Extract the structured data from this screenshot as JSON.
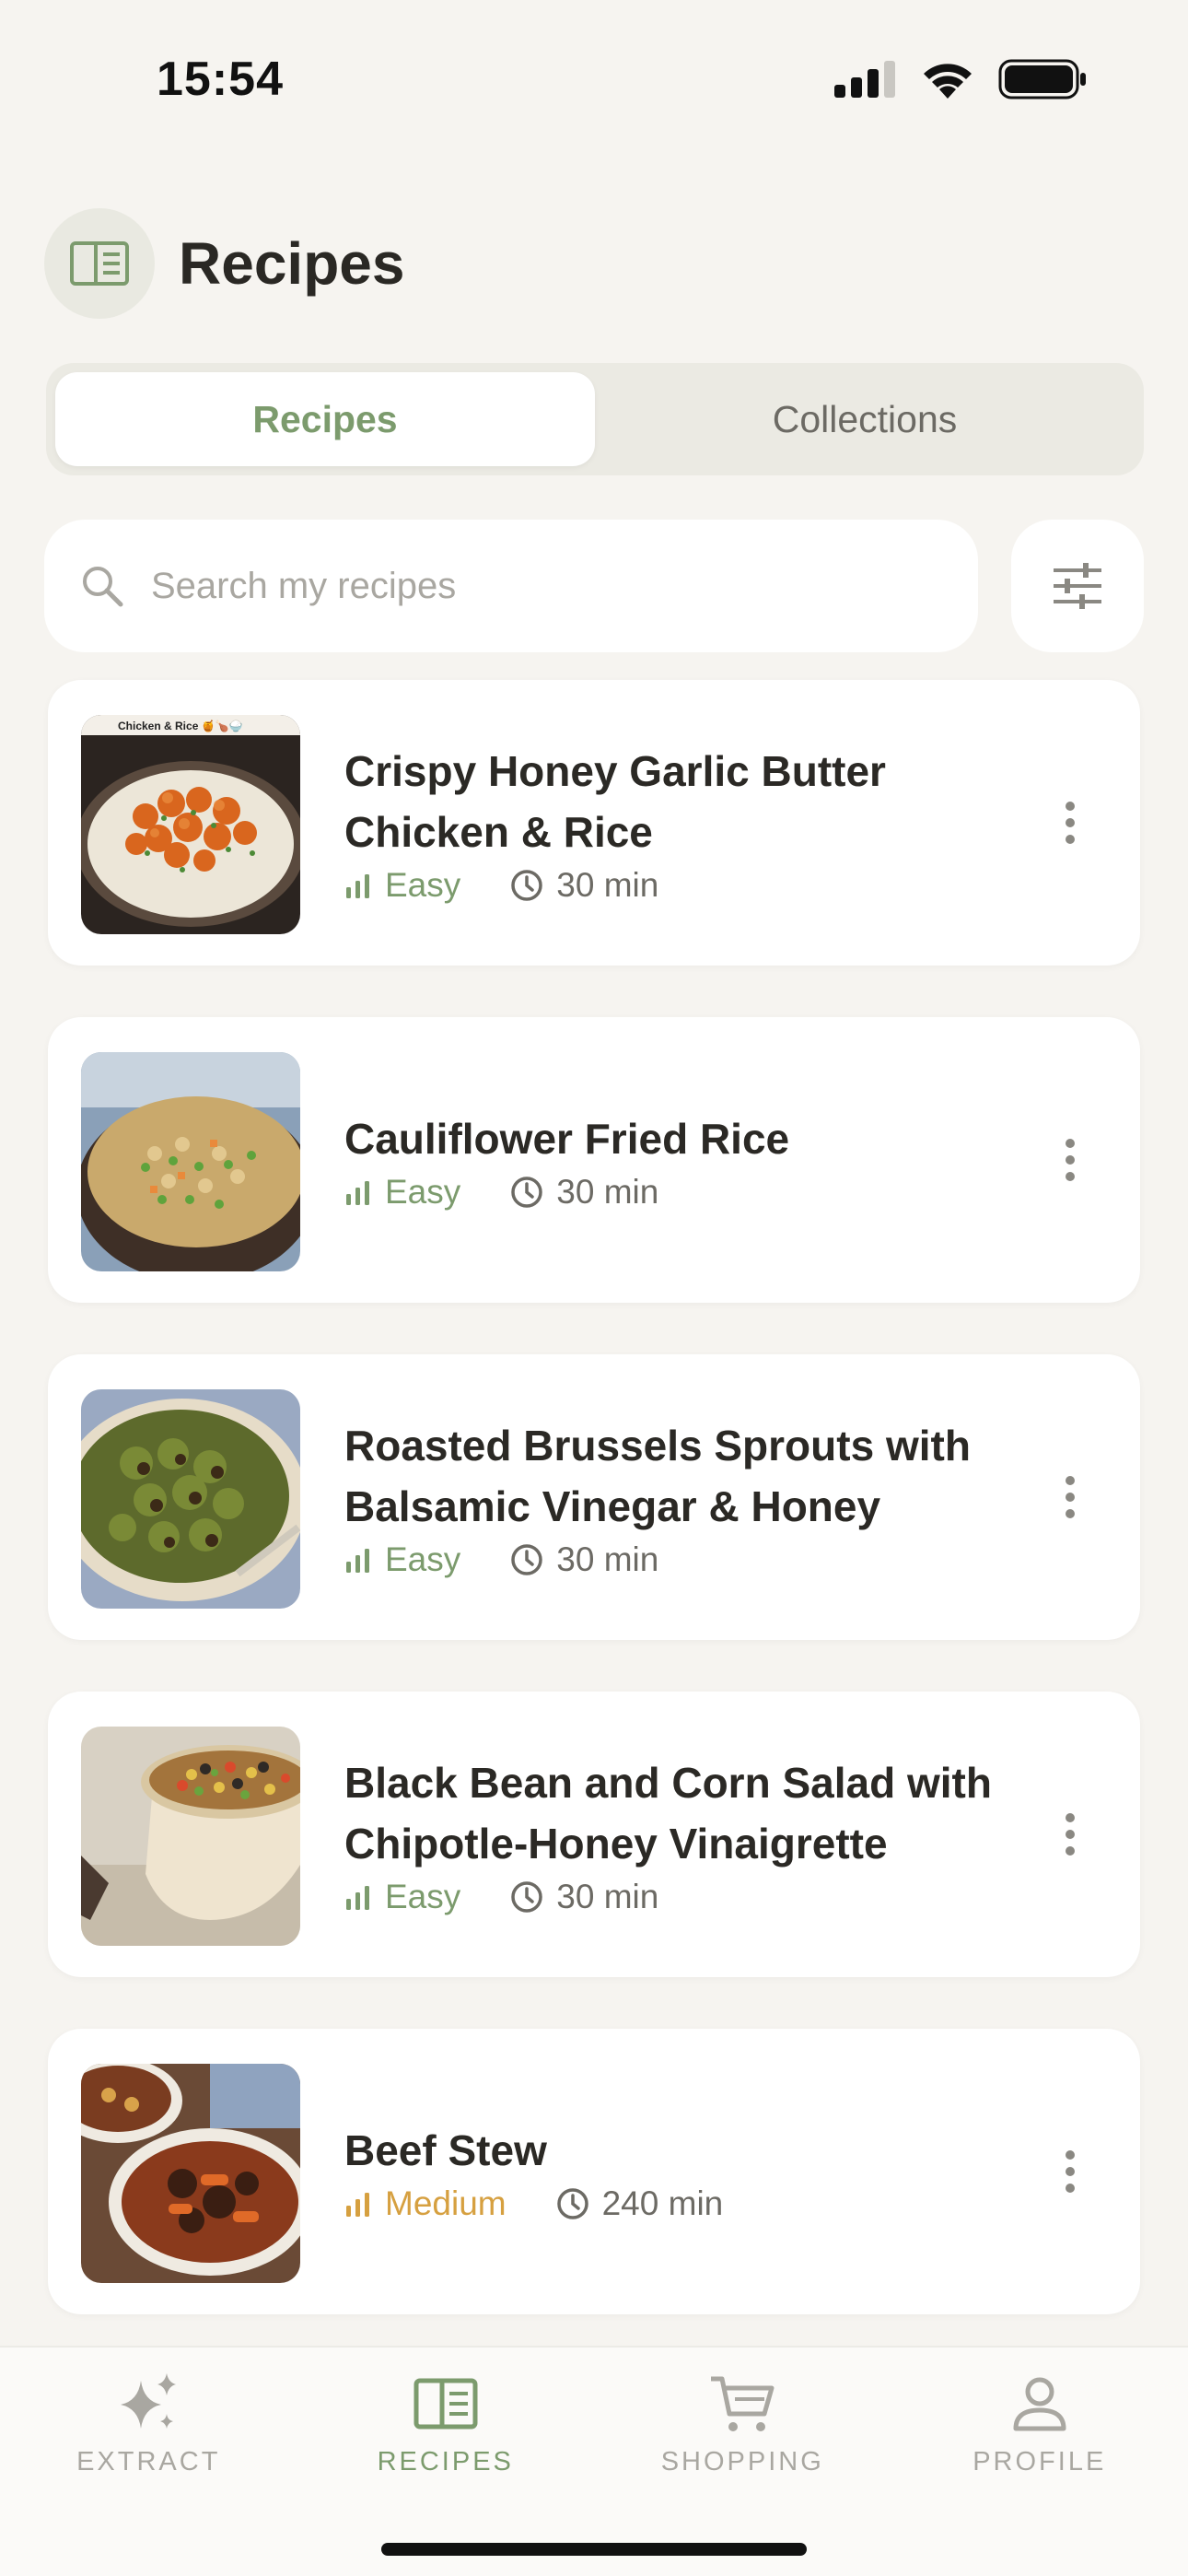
{
  "status_bar": {
    "time": "15:54"
  },
  "header": {
    "title": "Recipes",
    "logo_icon": "book-icon"
  },
  "segments": [
    {
      "label": "Recipes",
      "active": true
    },
    {
      "label": "Collections",
      "active": false
    }
  ],
  "search": {
    "placeholder": "Search my recipes",
    "icon": "search-icon",
    "filter_icon": "sliders-icon"
  },
  "recipes": [
    {
      "title": "Crispy Honey Garlic Butter Chicken & Rice",
      "difficulty": "Easy",
      "time": "30 min",
      "thumb_text": "Chicken & Rice 🍯🍗🍚"
    },
    {
      "title": "Cauliflower Fried Rice",
      "difficulty": "Easy",
      "time": "30 min"
    },
    {
      "title": "Roasted Brussels Sprouts with Balsamic Vinegar & Honey",
      "difficulty": "Easy",
      "time": "30 min"
    },
    {
      "title": "Black Bean and Corn Salad with Chipotle-Honey Vinaigrette",
      "difficulty": "Easy",
      "time": "30 min"
    },
    {
      "title": "Beef Stew",
      "difficulty": "Medium",
      "time": "240 min"
    }
  ],
  "tabs": [
    {
      "label": "EXTRACT",
      "icon": "sparkles-icon",
      "active": false
    },
    {
      "label": "RECIPES",
      "icon": "book-icon",
      "active": true
    },
    {
      "label": "SHOPPING",
      "icon": "cart-icon",
      "active": false
    },
    {
      "label": "PROFILE",
      "icon": "person-icon",
      "active": false
    }
  ],
  "colors": {
    "accent": "#7c9b6d",
    "medium": "#d6a040",
    "background": "#f6f4f0"
  }
}
